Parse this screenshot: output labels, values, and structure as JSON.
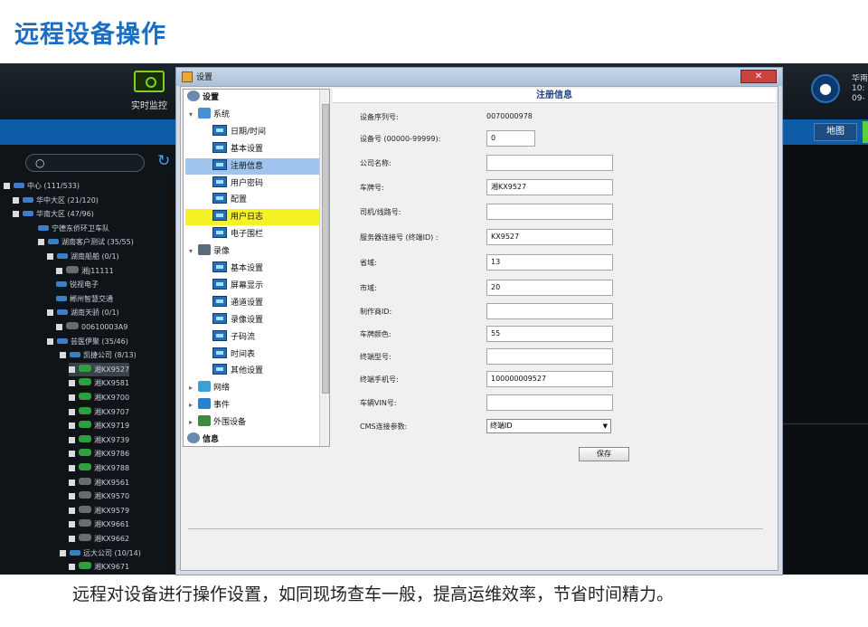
{
  "page_title": "远程设备操作",
  "caption": "远程对设备进行操作设置，如同现场查车一般，提高运维效率，节省时间精力。",
  "colors": {
    "title_blue": "#1a6fc4",
    "bar_blue": "#0e5ca8",
    "highlight_yellow": "#f5f227",
    "select_blue": "#9fc4ee"
  },
  "app": {
    "monitor_label": "实时监控",
    "map_button": "地图",
    "user_text": "华南 10: 09-",
    "tree": [
      {
        "label": "中心 (111/533)",
        "box": true,
        "icon": "group"
      },
      {
        "label": "华中大区 (21/120)",
        "box": true,
        "icon": "group"
      },
      {
        "label": "华南大区 (47/96)",
        "box": true,
        "icon": "group"
      },
      {
        "label": "宁德东侨环卫车队",
        "box": false,
        "icon": "group"
      },
      {
        "label": "湖南客户测试 (35/55)",
        "box": true,
        "icon": "group"
      },
      {
        "label": "湖南船舶 (0/1)",
        "box": true,
        "icon": "group"
      },
      {
        "label": "湘j11111",
        "box": true,
        "icon": "off"
      },
      {
        "label": "锐视电子",
        "box": false,
        "icon": "group"
      },
      {
        "label": "郴州智慧交通",
        "box": false,
        "icon": "group"
      },
      {
        "label": "湖南天骄 (0/1)",
        "box": true,
        "icon": "group"
      },
      {
        "label": "00610003A9",
        "box": true,
        "icon": "off"
      },
      {
        "label": "芸医伊聚 (35/46)",
        "box": true,
        "icon": "group"
      },
      {
        "label": "凯捷公司 (8/13)",
        "box": true,
        "icon": "group"
      },
      {
        "label": "湘KX9527",
        "box": true,
        "icon": "car",
        "selected": true
      },
      {
        "label": "湘KX9581",
        "box": true,
        "icon": "car"
      },
      {
        "label": "湘KX9700",
        "box": true,
        "icon": "car"
      },
      {
        "label": "湘KX9707",
        "box": true,
        "icon": "car"
      },
      {
        "label": "湘KX9719",
        "box": true,
        "icon": "car"
      },
      {
        "label": "湘KX9739",
        "box": true,
        "icon": "car"
      },
      {
        "label": "湘KX9786",
        "box": true,
        "icon": "car"
      },
      {
        "label": "湘KX9788",
        "box": true,
        "icon": "car"
      },
      {
        "label": "湘KX9561",
        "box": true,
        "icon": "off"
      },
      {
        "label": "湘KX9570",
        "box": true,
        "icon": "off"
      },
      {
        "label": "湘KX9579",
        "box": true,
        "icon": "off"
      },
      {
        "label": "湘KX9661",
        "box": true,
        "icon": "off"
      },
      {
        "label": "湘KX9662",
        "box": true,
        "icon": "off"
      },
      {
        "label": "远大公司 (10/14)",
        "box": true,
        "icon": "group"
      },
      {
        "label": "湘KX9671",
        "box": true,
        "icon": "car"
      }
    ]
  },
  "dialog": {
    "title": "设置",
    "close": "✕",
    "nav": [
      {
        "label": "设置",
        "type": "root"
      },
      {
        "label": "系统",
        "type": "group",
        "caret": "▾"
      },
      {
        "label": "日期/时间",
        "type": "leaf"
      },
      {
        "label": "基本设置",
        "type": "leaf"
      },
      {
        "label": "注册信息",
        "type": "leaf",
        "state": "selected"
      },
      {
        "label": "用户密码",
        "type": "leaf"
      },
      {
        "label": "配置",
        "type": "leaf"
      },
      {
        "label": "用户日志",
        "type": "leaf",
        "state": "highlight"
      },
      {
        "label": "电子围栏",
        "type": "leaf"
      },
      {
        "label": "录像",
        "type": "group",
        "caret": "▾"
      },
      {
        "label": "基本设置",
        "type": "leaf"
      },
      {
        "label": "屏幕显示",
        "type": "leaf"
      },
      {
        "label": "通道设置",
        "type": "leaf"
      },
      {
        "label": "录像设置",
        "type": "leaf"
      },
      {
        "label": "子码流",
        "type": "leaf"
      },
      {
        "label": "时间表",
        "type": "leaf"
      },
      {
        "label": "其他设置",
        "type": "leaf"
      },
      {
        "label": "网络",
        "type": "group",
        "caret": "▸"
      },
      {
        "label": "事件",
        "type": "group",
        "caret": "▸"
      },
      {
        "label": "外围设备",
        "type": "group",
        "caret": "▸"
      },
      {
        "label": "信息",
        "type": "root"
      }
    ],
    "panel_title": "注册信息",
    "fields": [
      {
        "label": "设备序列号:",
        "value": "0070000978",
        "kind": "text"
      },
      {
        "label": "设备号 (00000-99999):",
        "value": "0",
        "kind": "input",
        "w": 54
      },
      {
        "label": "公司名称:",
        "value": "",
        "kind": "input",
        "w": 140
      },
      {
        "label": "车牌号:",
        "value": "湘KX9527",
        "kind": "input",
        "w": 140
      },
      {
        "label": "司机/线路号:",
        "value": "",
        "kind": "input",
        "w": 140
      },
      {
        "label": "服务器连接号 (终端ID) :",
        "value": "KX9527",
        "kind": "input",
        "w": 140
      },
      {
        "label": "省域:",
        "value": "13",
        "kind": "input",
        "w": 140
      },
      {
        "label": "市域:",
        "value": "20",
        "kind": "input",
        "w": 140
      },
      {
        "label": "制作商ID:",
        "value": "",
        "kind": "input",
        "w": 140
      },
      {
        "label": "车牌颜色:",
        "value": "55",
        "kind": "input",
        "w": 140
      },
      {
        "label": "终端型号:",
        "value": "",
        "kind": "input",
        "w": 140
      },
      {
        "label": "终端手机号:",
        "value": "100000009527",
        "kind": "input",
        "w": 140
      },
      {
        "label": "车辆VIN号:",
        "value": "",
        "kind": "input",
        "w": 140
      },
      {
        "label": "CMS连接参数:",
        "value": "终端ID",
        "kind": "select"
      }
    ],
    "save_label": "保存"
  }
}
